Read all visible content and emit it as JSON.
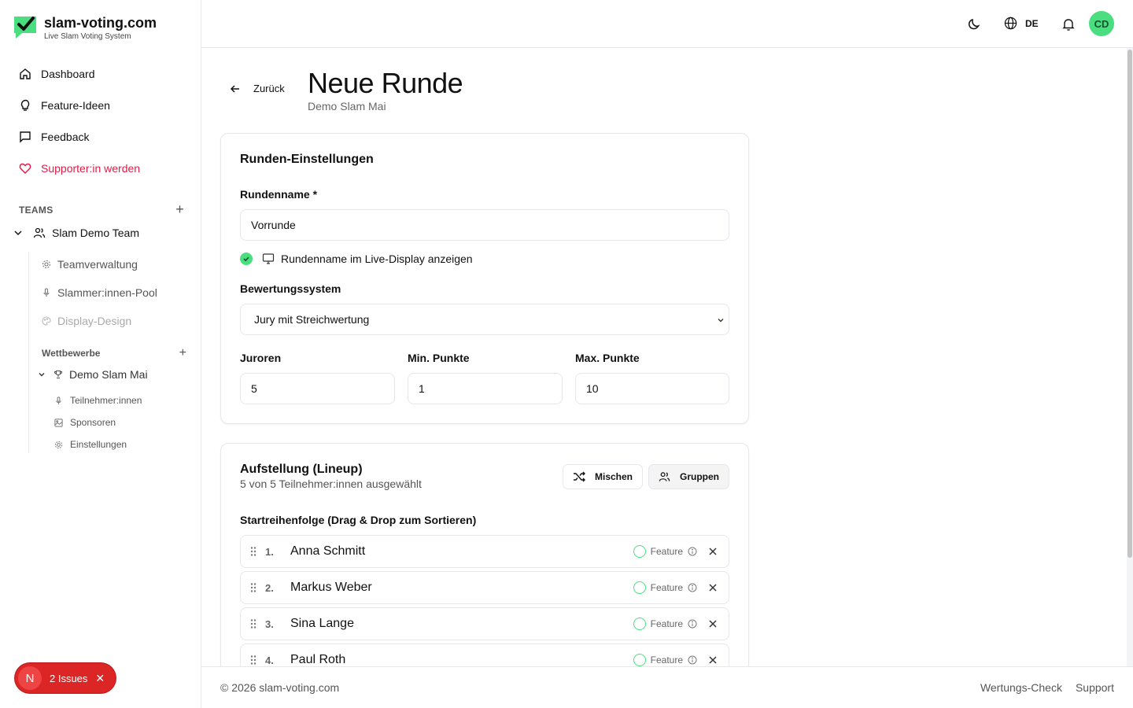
{
  "brand": {
    "title": "slam-voting.com",
    "subtitle": "Live Slam Voting System"
  },
  "nav": {
    "dashboard": "Dashboard",
    "feature_ideas": "Feature-Ideen",
    "feedback": "Feedback",
    "supporter": "Supporter:in werden"
  },
  "teams": {
    "heading": "TEAMS",
    "team_name": "Slam Demo Team",
    "items": [
      "Teamverwaltung",
      "Slammer:innen-Pool",
      "Display-Design"
    ],
    "competitions_heading": "Wettbewerbe",
    "competition_name": "Demo Slam Mai",
    "competition_items": [
      "Teilnehmer:innen",
      "Sponsoren",
      "Einstellungen"
    ]
  },
  "issues": {
    "letter": "N",
    "label": "2 Issues"
  },
  "header": {
    "language": "DE",
    "avatar_initials": "CD"
  },
  "page": {
    "back_label": "Zurück",
    "title": "Neue Runde",
    "subtitle": "Demo Slam Mai"
  },
  "settings": {
    "title": "Runden-Einstellungen",
    "round_name_label": "Rundenname *",
    "round_name_value": "Vorrunde",
    "show_in_display_label": "Rundenname im Live-Display anzeigen",
    "scoring_label": "Bewertungssystem",
    "scoring_value": "Jury mit Streichwertung",
    "jurors_label": "Juroren",
    "jurors_value": "5",
    "min_points_label": "Min. Punkte",
    "min_points_value": "1",
    "max_points_label": "Max. Punkte",
    "max_points_value": "10"
  },
  "lineup": {
    "title": "Aufstellung (Lineup)",
    "subtitle": "5 von 5 Teilnehmer:innen ausgewählt",
    "shuffle_label": "Mischen",
    "groups_label": "Gruppen",
    "order_label": "Startreihenfolge (Drag & Drop zum Sortieren)",
    "feature_label": "Feature",
    "participants": [
      {
        "num": "1.",
        "name": "Anna Schmitt"
      },
      {
        "num": "2.",
        "name": "Markus Weber"
      },
      {
        "num": "3.",
        "name": "Sina Lange"
      },
      {
        "num": "4.",
        "name": "Paul Roth"
      }
    ]
  },
  "footer": {
    "copyright": "© 2026 slam-voting.com",
    "check_link": "Wertungs-Check",
    "support_link": "Support"
  },
  "colors": {
    "accent_green": "#4ade80",
    "danger": "#e11d48",
    "issues_red": "#dc2626"
  }
}
